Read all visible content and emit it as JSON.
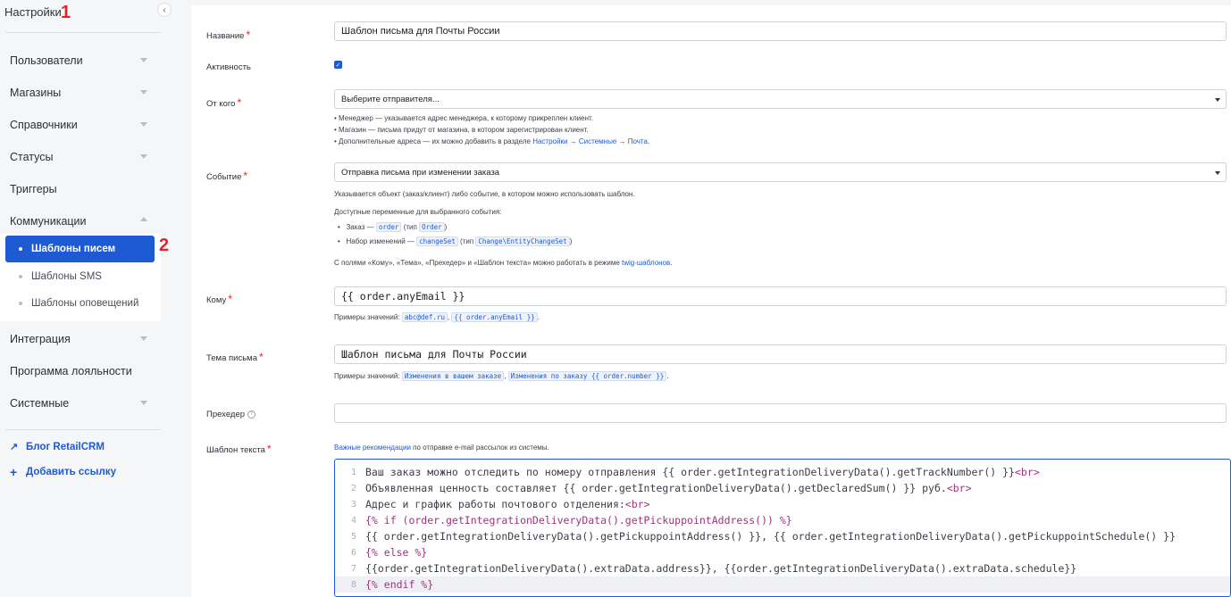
{
  "sidebar": {
    "title": "Настройки",
    "markers": {
      "one": "1",
      "two": "2"
    },
    "items": [
      {
        "label": "Пользователи",
        "caret": "chevron-down"
      },
      {
        "label": "Магазины",
        "caret": "chevron-down"
      },
      {
        "label": "Справочники",
        "caret": "chevron-down"
      },
      {
        "label": "Статусы",
        "caret": "chevron-down"
      },
      {
        "label": "Триггеры",
        "caret": ""
      },
      {
        "label": "Коммуникации",
        "caret": "chevron-up"
      }
    ],
    "sub_items": [
      {
        "label": "Шаблоны писем",
        "active": true
      },
      {
        "label": "Шаблоны SMS",
        "active": false
      },
      {
        "label": "Шаблоны оповещений",
        "active": false
      }
    ],
    "items_after": [
      {
        "label": "Интеграция",
        "caret": "chevron-down"
      },
      {
        "label": "Программа лояльности",
        "caret": ""
      },
      {
        "label": "Системные",
        "caret": "chevron-down"
      }
    ],
    "links": [
      {
        "icon": "arrow-up-right-icon",
        "label": "Блог RetailCRM"
      },
      {
        "icon": "plus-icon",
        "label": "Добавить ссылку"
      }
    ]
  },
  "form": {
    "name": {
      "label": "Название",
      "value": "Шаблон письма для Почты России"
    },
    "active": {
      "label": "Активность",
      "checked": true
    },
    "from": {
      "label": "От кого",
      "value": "Выберите отправителя...",
      "hints": [
        "Менеджер — указывается адрес менеджера, к которому прикреплен клиент.",
        "Магазин — письма придут от магазина, в котором зарегистрирован клиент."
      ],
      "hint3_prefix": "Дополнительные адреса — их можно добавить в разделе ",
      "hint3_link1": "Настройки",
      "hint3_arrow": " → ",
      "hint3_link2": "Системные",
      "hint3_link3": "Почта",
      "hint3_end": "."
    },
    "event": {
      "label": "Событие",
      "value": "Отправка письма при изменении заказа",
      "hint1": "Указывается объект (заказ/клиент) либо событие, в котором можно использовать шаблон.",
      "hint2": "Доступные переменные для выбранного события:",
      "var1_text": "Заказ — ",
      "var1_code": "order",
      "var1_type_pre": " (тип ",
      "var1_type": "Order",
      "var1_type_post": ")",
      "var2_text": "Набор изменений — ",
      "var2_code": "changeSet",
      "var2_type_pre": " (тип ",
      "var2_type": "Change\\EntityChangeSet",
      "var2_type_post": ")",
      "hint3_prefix": "С полями «Кому», «Тема», «Прехедер» и «Шаблон текста» можно работать в режиме ",
      "hint3_link": "twig-шаблонов",
      "hint3_end": "."
    },
    "to": {
      "label": "Кому",
      "value": "{{ order.anyEmail }}",
      "examples_prefix": "Примеры значений: ",
      "ex1": "abc@def.ru",
      "ex2": "{{ order.anyEmail }}",
      "sep": ", ",
      "end": "."
    },
    "subject": {
      "label": "Тема письма",
      "value": "Шаблон письма для Почты России",
      "examples_prefix": "Примеры значений: ",
      "ex1": "Изменения в вашем заказе",
      "ex2": "Изменения по заказу {{ order.number }}",
      "sep": ", ",
      "end": "."
    },
    "preheader": {
      "label": "Прехедер",
      "help": "?",
      "value": ""
    },
    "body": {
      "label": "Шаблон текста",
      "hint_link": "Важные рекомендации",
      "hint_text": " по отправке e-mail рассылок из системы.",
      "lines": [
        {
          "n": "1",
          "text": "Ваш заказ можно отследить по номеру отправления {{ order.getIntegrationDeliveryData().getTrackNumber() }}",
          "tag": "<br>"
        },
        {
          "n": "2",
          "text": "Объявленная ценность составляет {{ order.getIntegrationDeliveryData().getDeclaredSum() }} руб.",
          "tag": "<br>"
        },
        {
          "n": "3",
          "text": "Адрес и график работы почтового отделения:",
          "tag": "<br>"
        },
        {
          "n": "4",
          "text": "{% if (order.getIntegrationDeliveryData().getPickuppointAddress()) %}",
          "tag": ""
        },
        {
          "n": "5",
          "text": "{{ order.getIntegrationDeliveryData().getPickuppointAddress() }}, {{ order.getIntegrationDeliveryData().getPickuppointSchedule() }}",
          "tag": ""
        },
        {
          "n": "6",
          "text": "{% else %}",
          "tag": ""
        },
        {
          "n": "7",
          "text": "{{order.getIntegrationDeliveryData().extraData.address}}, {{order.getIntegrationDeliveryData().extraData.schedule}}",
          "tag": ""
        },
        {
          "n": "8",
          "text": "{% endif %}",
          "tag": ""
        }
      ]
    }
  },
  "colors": {
    "accent": "#1d5ad4",
    "required": "#e0262c",
    "marker": "#e0262c"
  }
}
